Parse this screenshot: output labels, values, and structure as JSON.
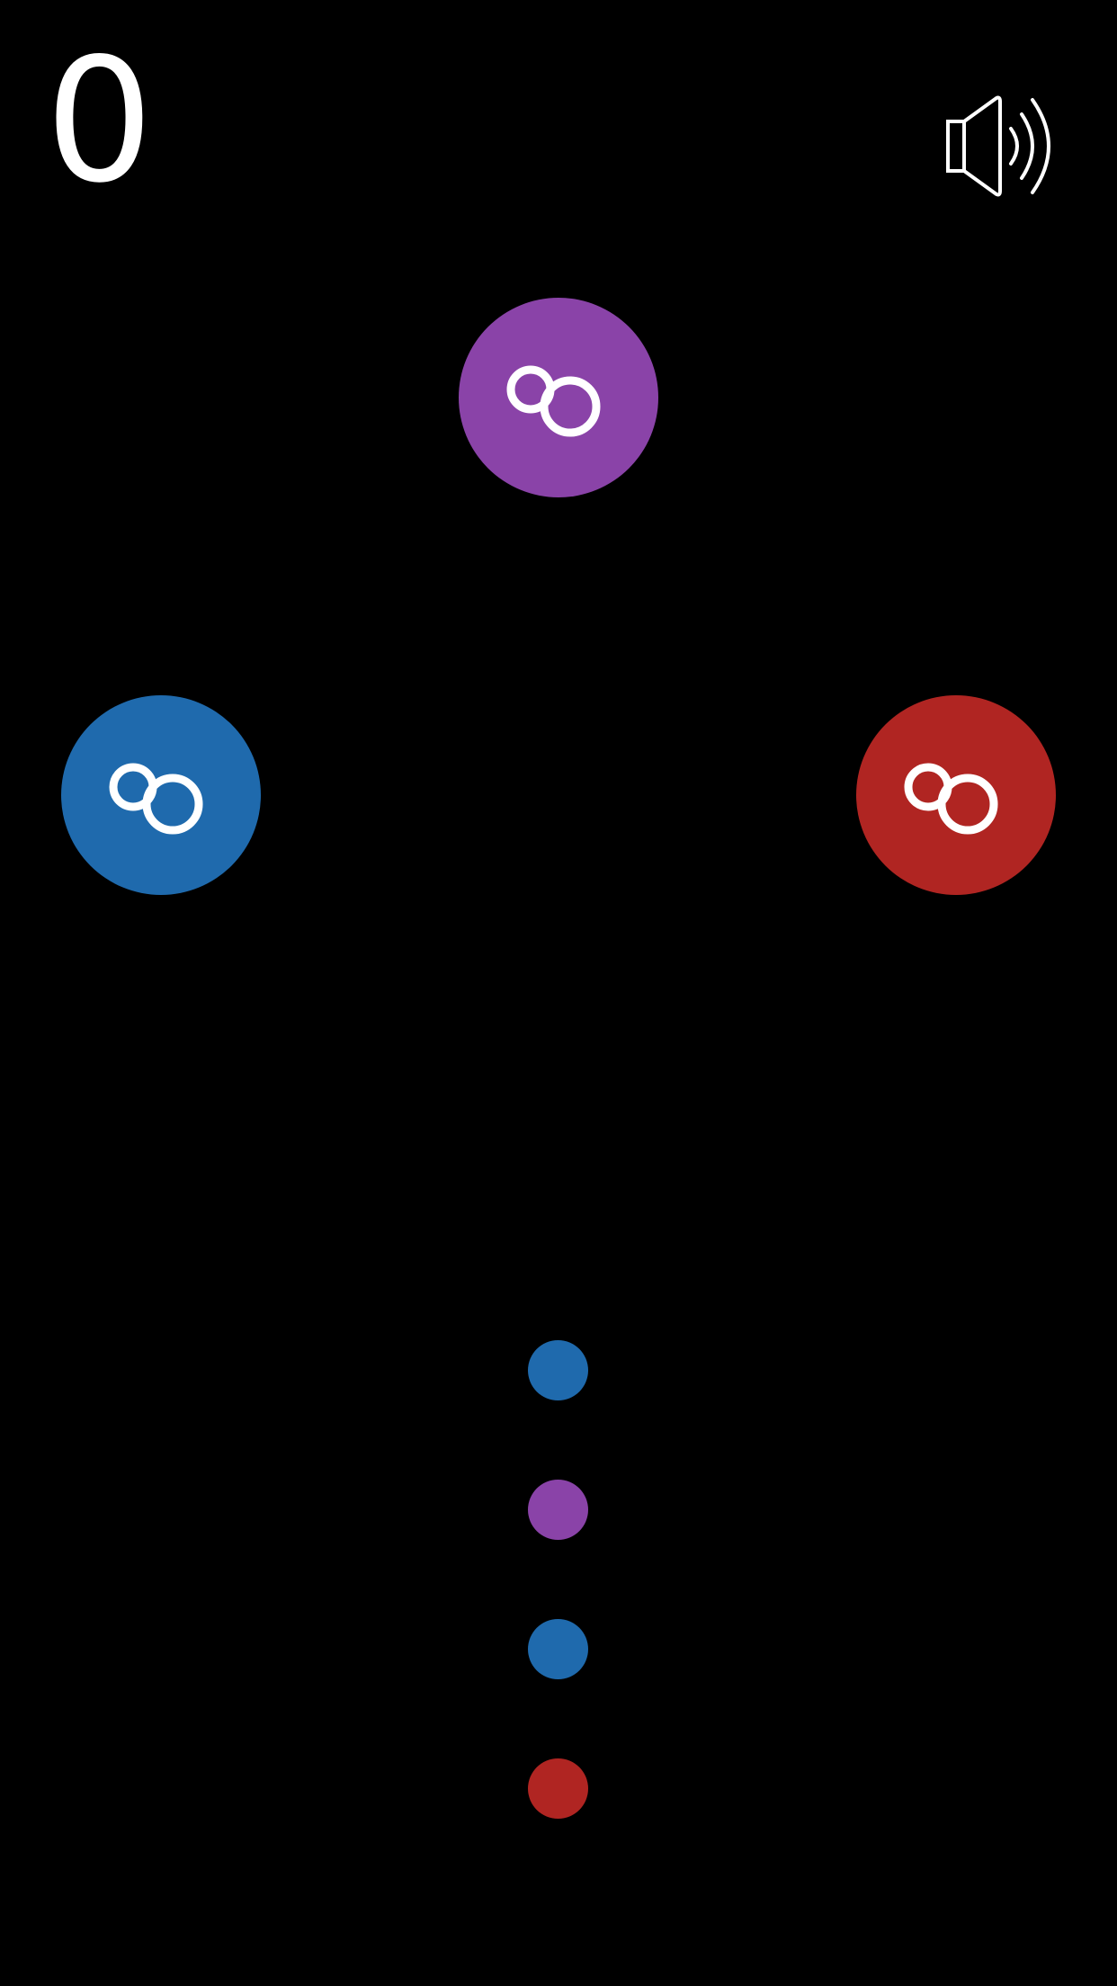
{
  "score": "0",
  "sound": {
    "icon": "speaker-on-icon",
    "state": "on"
  },
  "colors": {
    "background": "#000000",
    "purple": "#8a43a8",
    "blue": "#1f6aad",
    "red": "#b02522",
    "symbol": "#ffffff"
  },
  "targets": [
    {
      "id": "purple",
      "color": "#8a43a8",
      "icon": "double-ring-icon"
    },
    {
      "id": "blue",
      "color": "#1f6aad",
      "icon": "double-ring-icon"
    },
    {
      "id": "red",
      "color": "#b02522",
      "icon": "double-ring-icon"
    }
  ],
  "queue": [
    {
      "color": "#1f6aad",
      "name": "blue"
    },
    {
      "color": "#8a43a8",
      "name": "purple"
    },
    {
      "color": "#1f6aad",
      "name": "blue"
    },
    {
      "color": "#b02522",
      "name": "red"
    }
  ]
}
